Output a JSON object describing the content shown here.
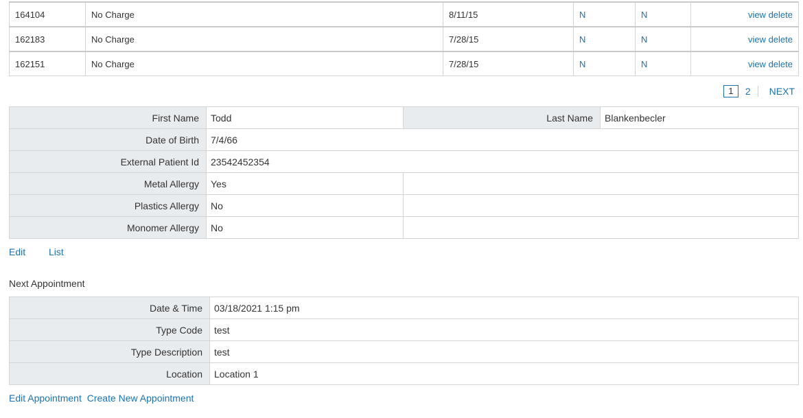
{
  "orders": [
    {
      "id": "164104",
      "charge": "No Charge",
      "date": "8/11/15",
      "flag1": "N",
      "flag2": "N",
      "view": "view",
      "delete": "delete"
    },
    {
      "id": "162183",
      "charge": "No Charge",
      "date": "7/28/15",
      "flag1": "N",
      "flag2": "N",
      "view": "view",
      "delete": "delete"
    },
    {
      "id": "162151",
      "charge": "No Charge",
      "date": "7/28/15",
      "flag1": "N",
      "flag2": "N",
      "view": "view",
      "delete": "delete"
    }
  ],
  "pagination": {
    "current": "1",
    "page2": "2",
    "next": "NEXT"
  },
  "patient": {
    "first_name_label": "First Name",
    "first_name": "Todd",
    "last_name_label": "Last Name",
    "last_name": "Blankenbecler",
    "dob_label": "Date of Birth",
    "dob": "7/4/66",
    "ext_id_label": "External Patient Id",
    "ext_id": "23542452354",
    "metal_label": "Metal Allergy",
    "metal": "Yes",
    "plastics_label": "Plastics Allergy",
    "plastics": "No",
    "monomer_label": "Monomer Allergy",
    "monomer": "No"
  },
  "patient_links": {
    "edit": "Edit",
    "list": "List"
  },
  "appointment": {
    "section_title": "Next Appointment",
    "datetime_label": "Date & Time",
    "datetime": "03/18/2021 1:15 pm",
    "type_code_label": "Type Code",
    "type_code": "test",
    "type_desc_label": "Type Description",
    "type_desc": "test",
    "location_label": "Location",
    "location": "Location 1"
  },
  "appointment_links": {
    "edit": "Edit Appointment",
    "create": "Create New Appointment"
  },
  "colors": {
    "link": "#1a73b0",
    "label_bg": "#e9ecef",
    "border": "#d4d4d4"
  }
}
